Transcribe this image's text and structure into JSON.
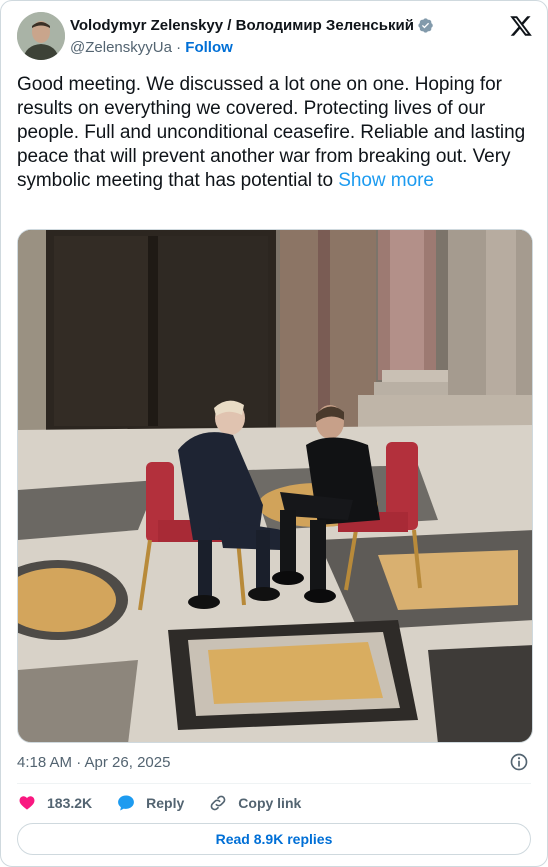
{
  "author": {
    "display_name": "Volodymyr Zelenskyy / Володимир Зеленський",
    "handle": "@ZelenskyyUa",
    "separator": "·",
    "follow_label": "Follow"
  },
  "tweet": {
    "text": "Good meeting. We discussed a lot one on one. Hoping for results on everything we covered. Protecting lives of our people. Full and unconditional ceasefire. Reliable and lasting peace that will prevent another war from breaking out. Very symbolic meeting that has potential to ",
    "show_more_label": "Show more",
    "timestamp": "4:18 AM · Apr 26, 2025"
  },
  "actions": {
    "likes": "183.2K",
    "reply_label": "Reply",
    "copy_link_label": "Copy link"
  },
  "replies_button_label": "Read 8.9K replies",
  "colors": {
    "like_red": "#f91880",
    "link_blue": "#1d9bf0",
    "follow_blue": "#006fd6",
    "verified_blue": "#1d9bf0"
  },
  "icons": [
    "x-logo-icon",
    "verified-badge-icon",
    "info-icon",
    "heart-icon",
    "reply-icon",
    "link-icon"
  ]
}
